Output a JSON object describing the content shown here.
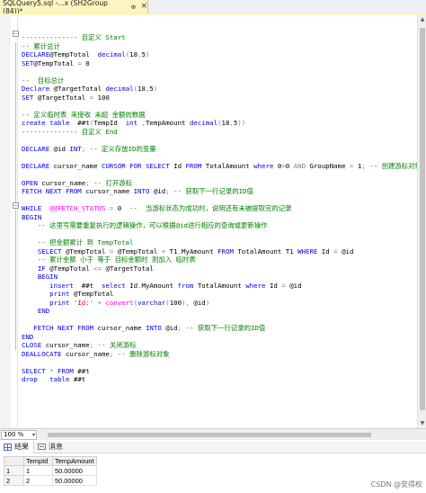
{
  "tab": {
    "title": "SQLQuery5.sql -...x (SH2Group (84))*",
    "pin_glyph": "⊕",
    "close_glyph": "×"
  },
  "editor": {
    "lines": [
      [
        [
          "cm",
          "-------------- 自定义 Start"
        ]
      ],
      [
        [
          "cm",
          "-- 累计总计"
        ]
      ],
      [
        [
          "kw",
          "DECLARE"
        ],
        [
          "",
          "@TempTotal  "
        ],
        [
          "kw",
          "decimal"
        ],
        [
          "gr",
          "("
        ],
        [
          "",
          "18"
        ],
        [
          "gr",
          ","
        ],
        [
          "",
          "5"
        ],
        [
          "gr",
          ")"
        ]
      ],
      [
        [
          "kw",
          "SET"
        ],
        [
          "",
          "@TempTotal "
        ],
        [
          "gr",
          "="
        ],
        [
          "",
          " 0"
        ]
      ],
      [
        [
          "",
          ""
        ]
      ],
      [
        [
          "cm",
          "--  目标总计"
        ]
      ],
      [
        [
          "kw",
          "Declare"
        ],
        [
          "",
          " @TargetTotal "
        ],
        [
          "kw",
          "decimal"
        ],
        [
          "gr",
          "("
        ],
        [
          "",
          "18"
        ],
        [
          "gr",
          ","
        ],
        [
          "",
          "5"
        ],
        [
          "gr",
          ")"
        ]
      ],
      [
        [
          "kw",
          "SET"
        ],
        [
          "",
          " @TargetTotal "
        ],
        [
          "gr",
          "="
        ],
        [
          "",
          " 100"
        ]
      ],
      [
        [
          "",
          ""
        ]
      ],
      [
        [
          "cm",
          "-- 定义临时表 来接收 未超 金额的数据"
        ]
      ],
      [
        [
          "kw",
          "create table"
        ],
        [
          "",
          "  ##t"
        ],
        [
          "gr",
          "("
        ],
        [
          "",
          "TempId  "
        ],
        [
          "kw",
          "int"
        ],
        [
          "gr",
          " ,"
        ],
        [
          "",
          "TempAmount "
        ],
        [
          "kw",
          "decimal"
        ],
        [
          "gr",
          "("
        ],
        [
          "",
          "18"
        ],
        [
          "gr",
          ","
        ],
        [
          "",
          "5"
        ],
        [
          "gr",
          "))"
        ]
      ],
      [
        [
          "cm",
          "-------------- 自定义 End"
        ]
      ],
      [
        [
          "",
          ""
        ]
      ],
      [
        [
          "kw",
          "DECLARE"
        ],
        [
          "",
          " @id "
        ],
        [
          "kw",
          "INT"
        ],
        [
          "gr",
          ";"
        ],
        [
          "cm",
          " -- 定义存放ID的变量"
        ]
      ],
      [
        [
          "",
          ""
        ]
      ],
      [
        [
          "kw",
          "DECLARE"
        ],
        [
          "",
          " cursor_name "
        ],
        [
          "kw",
          "CURSOR FOR SELECT"
        ],
        [
          "",
          " Id "
        ],
        [
          "kw",
          "FROM"
        ],
        [
          "",
          " TotalAmount "
        ],
        [
          "kw",
          "where"
        ],
        [
          "",
          " 0"
        ],
        [
          "gr",
          "="
        ],
        [
          "",
          "0 "
        ],
        [
          "gr",
          "AND"
        ],
        [
          "",
          " GroupName "
        ],
        [
          "gr",
          "="
        ],
        [
          "",
          " 1"
        ],
        [
          "gr",
          ";"
        ],
        [
          "cm",
          " -- 创建游标对象并"
        ]
      ],
      [
        [
          "",
          ""
        ]
      ],
      [
        [
          "kw",
          "OPEN"
        ],
        [
          "",
          " cursor_name"
        ],
        [
          "gr",
          ";"
        ],
        [
          "cm",
          " -- 打开游标"
        ]
      ],
      [
        [
          "kw",
          "FETCH NEXT FROM"
        ],
        [
          "",
          " cursor_name "
        ],
        [
          "kw",
          "INTO"
        ],
        [
          "",
          " @id"
        ],
        [
          "gr",
          ";"
        ],
        [
          "cm",
          " -- 获取下一行记录的ID值"
        ]
      ],
      [
        [
          "",
          ""
        ]
      ],
      [
        [
          "kw",
          "WHILE"
        ],
        [
          "",
          "  "
        ],
        [
          "sys",
          "@@FETCH_STATUS"
        ],
        [
          "",
          " "
        ],
        [
          "gr",
          "="
        ],
        [
          "",
          " 0  "
        ],
        [
          "cm",
          "--  当游标状态为成功时，说明还有未被提取完的记录"
        ]
      ],
      [
        [
          "kw",
          "BEGIN"
        ]
      ],
      [
        [
          "cm",
          "    -- 这里写需要重复执行的逻辑操作，可以根据@id进行相应的查询或更新操作"
        ]
      ],
      [
        [
          "",
          ""
        ]
      ],
      [
        [
          "cm",
          "    -- 把金额累计 到 TempTotal"
        ]
      ],
      [
        [
          "",
          "    "
        ],
        [
          "kw",
          "SELECT"
        ],
        [
          "",
          " @TempTotal "
        ],
        [
          "gr",
          "="
        ],
        [
          "",
          " @TempTotal "
        ],
        [
          "gr",
          "+"
        ],
        [
          "",
          " T1"
        ],
        [
          "gr",
          "."
        ],
        [
          "",
          "MyAmount "
        ],
        [
          "kw",
          "FROM"
        ],
        [
          "",
          " TotalAmount T1 "
        ],
        [
          "kw",
          "WHERE"
        ],
        [
          "",
          " Id "
        ],
        [
          "gr",
          "="
        ],
        [
          "",
          " @id"
        ]
      ],
      [
        [
          "cm",
          "    -- 累计金额 小于 等于 目标金额时 则加入 临时表"
        ]
      ],
      [
        [
          "",
          "    "
        ],
        [
          "kw",
          "IF"
        ],
        [
          "",
          " @TempTotal "
        ],
        [
          "gr",
          "<="
        ],
        [
          "",
          " @TargetTotal"
        ]
      ],
      [
        [
          "",
          "    "
        ],
        [
          "kw",
          "BEGIN"
        ]
      ],
      [
        [
          "",
          "       "
        ],
        [
          "kw",
          "insert"
        ],
        [
          "",
          "  ##t  "
        ],
        [
          "kw",
          "select"
        ],
        [
          "",
          " Id"
        ],
        [
          "gr",
          "."
        ],
        [
          "",
          "MyAmount "
        ],
        [
          "kw",
          "from"
        ],
        [
          "",
          " TotalAmount "
        ],
        [
          "kw",
          "where"
        ],
        [
          "",
          " Id "
        ],
        [
          "gr",
          "="
        ],
        [
          "",
          " @id"
        ]
      ],
      [
        [
          "",
          "       "
        ],
        [
          "kw",
          "print"
        ],
        [
          "",
          " @TempTotal"
        ]
      ],
      [
        [
          "",
          "       "
        ],
        [
          "kw",
          "print"
        ],
        [
          "str",
          " 'Id:' "
        ],
        [
          "gr",
          "+"
        ],
        [
          "fn",
          " convert"
        ],
        [
          "gr",
          "("
        ],
        [
          "kw",
          "varchar"
        ],
        [
          "gr",
          "("
        ],
        [
          "",
          "100"
        ],
        [
          "gr",
          "),"
        ],
        [
          "",
          " @id"
        ],
        [
          "gr",
          ")"
        ]
      ],
      [
        [
          "",
          "    "
        ],
        [
          "kw",
          "END"
        ]
      ],
      [
        [
          "",
          ""
        ]
      ],
      [
        [
          "",
          "   "
        ],
        [
          "kw",
          "FETCH NEXT FROM"
        ],
        [
          "",
          " cursor_name "
        ],
        [
          "kw",
          "INTO"
        ],
        [
          "",
          " @id"
        ],
        [
          "gr",
          ";"
        ],
        [
          "cm",
          " -- 获取下一行记录的ID值"
        ]
      ],
      [
        [
          "kw",
          "END"
        ]
      ],
      [
        [
          "kw",
          "CLOSE"
        ],
        [
          "",
          " cursor_name"
        ],
        [
          "gr",
          ";"
        ],
        [
          "cm",
          " -- 关闭游标"
        ]
      ],
      [
        [
          "kw",
          "DEALLOCATE"
        ],
        [
          "",
          " cursor_name"
        ],
        [
          "gr",
          ";"
        ],
        [
          "cm",
          " -- 删除游标对象"
        ]
      ],
      [
        [
          "",
          ""
        ]
      ],
      [
        [
          "kw",
          "SELECT"
        ],
        [
          "gr",
          " *"
        ],
        [
          "kw",
          " FROM"
        ],
        [
          "",
          " ##t"
        ]
      ],
      [
        [
          "kw",
          "drop"
        ],
        [
          "",
          "   "
        ],
        [
          "kw",
          "table"
        ],
        [
          "",
          " ##t"
        ]
      ]
    ]
  },
  "statusbar": {
    "zoom": "100 %",
    "zoom_dropdown_glyph": "▾"
  },
  "results_tabs": [
    {
      "label": "结果",
      "icon": "grid-icon",
      "active": true
    },
    {
      "label": "消息",
      "icon": "message-icon",
      "active": false
    }
  ],
  "results": {
    "columns": [
      "TempId",
      "TempAmount"
    ],
    "rows": [
      {
        "row_number": "1",
        "cells": [
          "1",
          "50.00000"
        ]
      },
      {
        "row_number": "2",
        "cells": [
          "2",
          "50.00000"
        ]
      }
    ]
  },
  "watermark": "CSDN @安得权"
}
